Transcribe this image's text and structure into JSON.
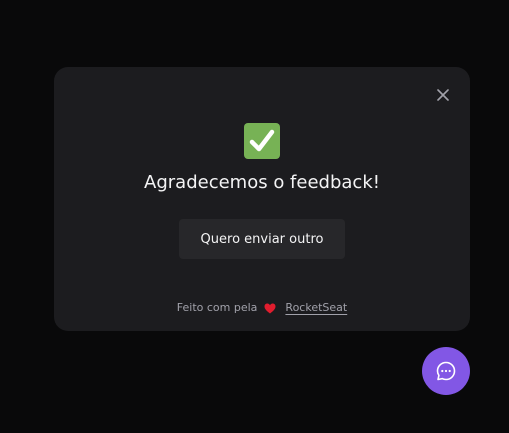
{
  "widget": {
    "title": "Agradecemos o feedback!",
    "again_button_label": "Quero enviar outro",
    "footer": {
      "prefix": "Feito com pela",
      "link_text": "RocketSeat"
    },
    "icons": {
      "close": "close-icon",
      "success": "check-mark-icon",
      "heart": "heart-icon",
      "launcher": "chat-bubble-icon"
    }
  },
  "colors": {
    "background": "#09090a",
    "card": "#1c1c1f",
    "button": "#27272a",
    "brand": "#8257e5",
    "success": "#77b255",
    "heart": "#e11d2e"
  }
}
